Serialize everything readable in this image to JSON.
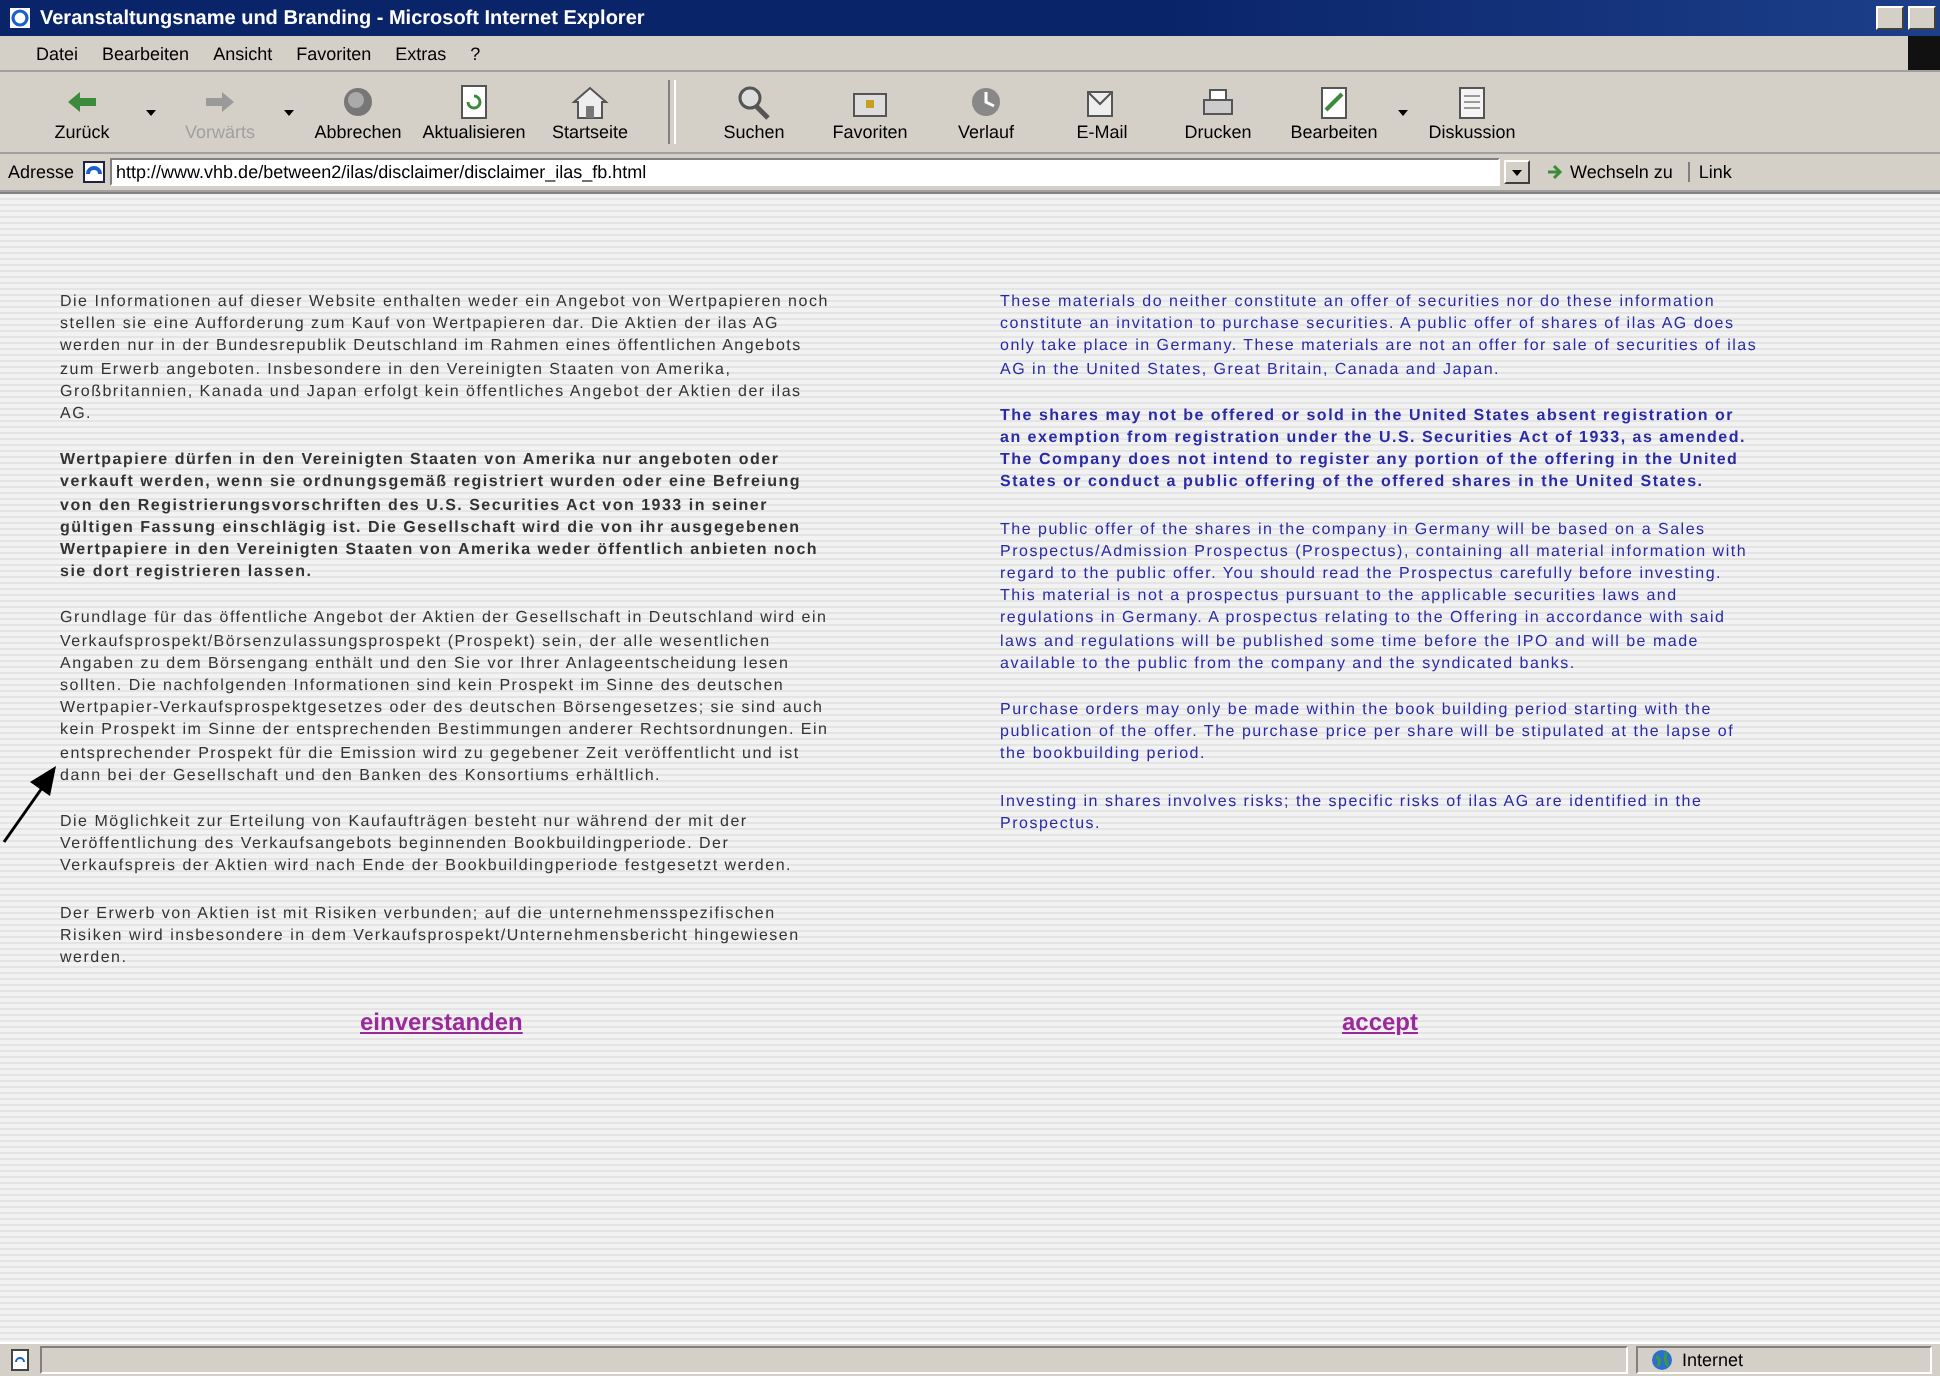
{
  "window": {
    "title": "Veranstaltungsname und Branding - Microsoft Internet Explorer"
  },
  "menu": [
    "Datei",
    "Bearbeiten",
    "Ansicht",
    "Favoriten",
    "Extras",
    "?"
  ],
  "toolbar": [
    {
      "label": "Zurück",
      "disabled": false,
      "dropdown": true
    },
    {
      "label": "Vorwärts",
      "disabled": true,
      "dropdown": true
    },
    {
      "label": "Abbrechen",
      "disabled": false,
      "dropdown": false
    },
    {
      "label": "Aktualisieren",
      "disabled": false,
      "dropdown": false
    },
    {
      "label": "Startseite",
      "disabled": false,
      "dropdown": false
    },
    {
      "label": "Suchen",
      "disabled": false,
      "dropdown": false
    },
    {
      "label": "Favoriten",
      "disabled": false,
      "dropdown": false
    },
    {
      "label": "Verlauf",
      "disabled": false,
      "dropdown": false
    },
    {
      "label": "E-Mail",
      "disabled": false,
      "dropdown": false
    },
    {
      "label": "Drucken",
      "disabled": false,
      "dropdown": false
    },
    {
      "label": "Bearbeiten",
      "disabled": false,
      "dropdown": true
    },
    {
      "label": "Diskussion",
      "disabled": false,
      "dropdown": false
    }
  ],
  "address_bar": {
    "label": "Adresse",
    "value": "http://www.vhb.de/between2/ilas/disclaimer/disclaimer_ilas_fb.html",
    "go": "Wechseln zu",
    "links": "Link"
  },
  "page": {
    "german": [
      {
        "text": "Die Informationen auf dieser Website enthalten weder ein Angebot von Wertpapieren noch stellen sie eine Aufforderung zum Kauf von Wertpapieren dar. Die Aktien der ilas AG werden nur in der Bundesrepublik Deutschland im Rahmen eines öffentlichen Angebots zum Erwerb angeboten. Insbesondere in den Vereinigten Staaten von Amerika, Großbritannien, Kanada und Japan erfolgt kein öffentliches Angebot der Aktien der ilas AG.",
        "bold": false
      },
      {
        "text": "Wertpapiere dürfen in den Vereinigten Staaten von Amerika nur angeboten oder verkauft werden, wenn sie ordnungsgemäß registriert wurden oder eine Befreiung von den Registrierungsvorschriften des U.S. Securities Act von 1933 in seiner gültigen Fassung einschlägig ist. Die Gesellschaft wird die von ihr ausgegebenen Wertpapiere in den Vereinigten Staaten von Amerika weder öffentlich anbieten noch sie dort registrieren lassen.",
        "bold": true
      },
      {
        "text": "Grundlage für das öffentliche Angebot der Aktien der Gesellschaft in Deutschland wird ein Verkaufsprospekt/Börsenzulassungsprospekt (Prospekt) sein, der alle wesentlichen Angaben zu dem Börsengang enthält und den Sie vor Ihrer Anlageentscheidung lesen sollten. Die nachfolgenden Informationen sind kein Prospekt im Sinne des deutschen Wertpapier-Verkaufsprospektgesetzes oder des deutschen Börsengesetzes; sie sind auch kein Prospekt im Sinne der entsprechenden Bestimmungen anderer Rechtsordnungen. Ein entsprechender Prospekt für die Emission wird zu gegebener Zeit veröffentlicht und ist dann bei der Gesellschaft und den Banken des Konsortiums erhältlich.",
        "bold": false
      },
      {
        "text": "Die Möglichkeit zur Erteilung von Kaufaufträgen besteht nur während der mit der Veröffentlichung des Verkaufsangebots beginnenden Bookbuildingperiode. Der Verkaufspreis der Aktien wird nach Ende der Bookbuildingperiode festgesetzt werden.",
        "bold": false
      },
      {
        "text": "Der Erwerb von Aktien ist mit Risiken verbunden; auf die unternehmensspezifischen Risiken wird insbesondere in dem Verkaufsprospekt/Unternehmensbericht hingewiesen werden.",
        "bold": false
      }
    ],
    "english": [
      {
        "text": "These materials do neither constitute an offer of securities nor do these information constitute an invitation to purchase securities. A public offer of shares of ilas AG does only take place in Germany. These materials are not an offer for sale of securities of ilas AG in the United States, Great Britain, Canada and Japan.",
        "bold": false
      },
      {
        "text": "The shares may not be offered or sold in the United States absent registration or an exemption from registration under the U.S. Securities Act of 1933, as amended. The Company does not intend to register any portion of the offering in the United States or conduct a public offering of the offered shares in the United States.",
        "bold": true
      },
      {
        "text": "The public offer of the shares in the company in Germany will be based on a Sales Prospectus/Admission Prospectus (Prospectus), containing all material information with regard to the public offer. You should read the Prospectus carefully before investing. This material is not a prospectus pursuant to the applicable securities laws and regulations in Germany. A prospectus relating to the Offering in accordance with said laws and regulations will be published some time before the IPO and will be made available to the public from the company and the syndicated banks.",
        "bold": false
      },
      {
        "text": "Purchase orders may only be made within the book building period starting with the publication of the offer. The purchase price per share will be stipulated at the lapse of the bookbuilding period.",
        "bold": false
      },
      {
        "text": "Investing in shares involves risks; the specific risks of ilas AG are identified in the Prospectus.",
        "bold": false
      }
    ],
    "german_link": "einverstanden",
    "english_link": "accept"
  },
  "status_bar": {
    "zone": "Internet"
  }
}
